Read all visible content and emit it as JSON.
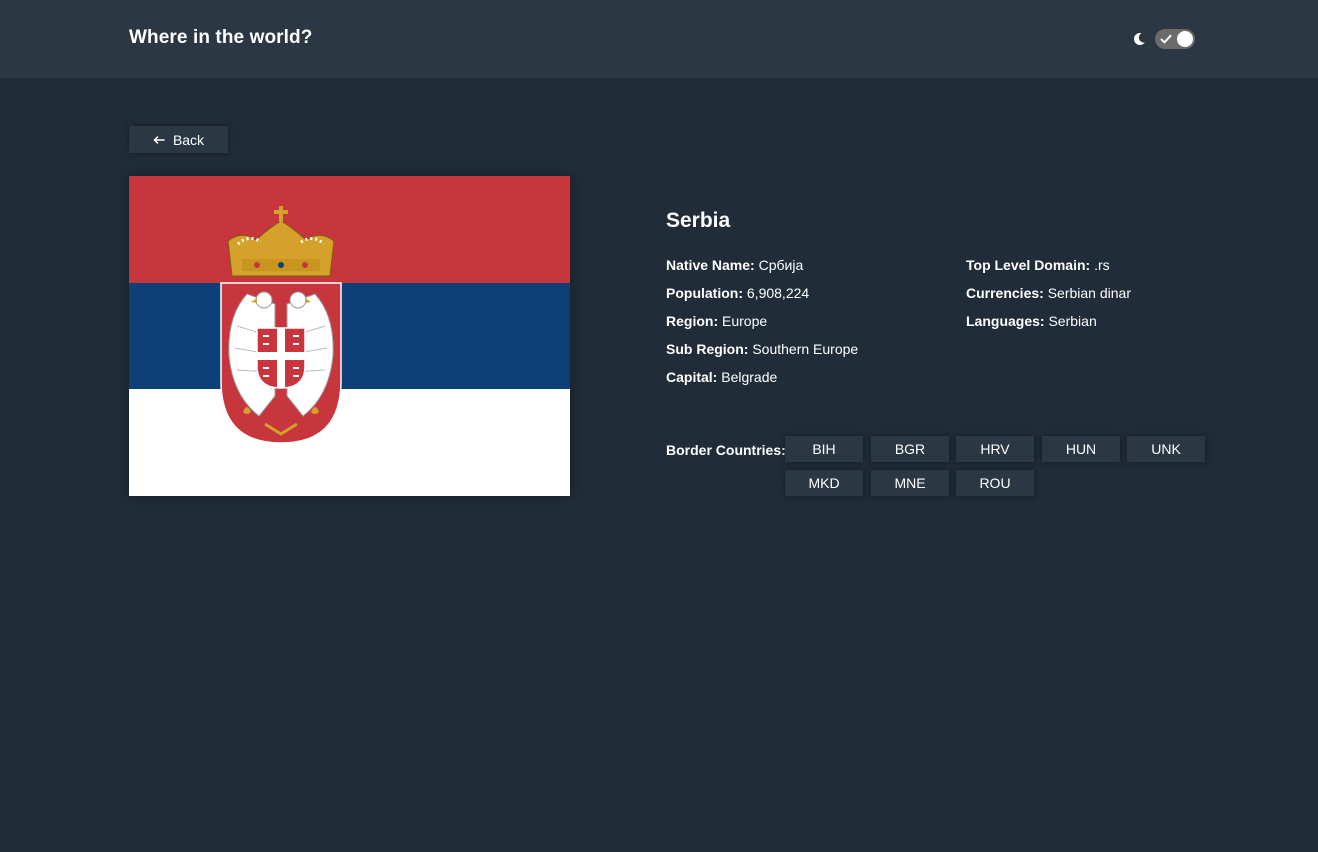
{
  "header": {
    "title": "Where in the world?"
  },
  "theme_toggle": {
    "icon": "moon-icon",
    "enabled": true
  },
  "back_button": {
    "label": "Back",
    "icon": "arrow-left-icon"
  },
  "country": {
    "name": "Serbia",
    "flag_colors": {
      "red": "#c6363c",
      "blue": "#0c4076",
      "white": "#ffffff"
    },
    "details_left": [
      {
        "label": "Native Name:",
        "value": "Србија"
      },
      {
        "label": "Population:",
        "value": "6,908,224"
      },
      {
        "label": "Region:",
        "value": "Europe"
      },
      {
        "label": "Sub Region:",
        "value": "Southern Europe"
      },
      {
        "label": "Capital:",
        "value": "Belgrade"
      }
    ],
    "details_right": [
      {
        "label": "Top Level Domain:",
        "value": ".rs"
      },
      {
        "label": "Currencies:",
        "value": "Serbian dinar"
      },
      {
        "label": "Languages:",
        "value": "Serbian"
      }
    ],
    "border_label": "Border Countries:",
    "borders": [
      "BIH",
      "BGR",
      "HRV",
      "HUN",
      "UNK",
      "MKD",
      "MNE",
      "ROU"
    ]
  },
  "colors": {
    "background": "#202c37",
    "surface": "#2b3844",
    "text": "#ffffff"
  }
}
